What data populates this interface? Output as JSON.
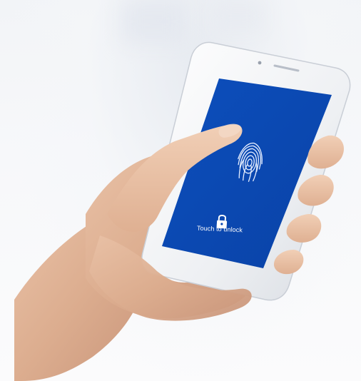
{
  "lock_screen": {
    "unlock_text": "Touch to unlock",
    "screen_color": "#0b48b3"
  },
  "icons": {
    "fingerprint": "fingerprint-icon",
    "lock": "lock-icon"
  }
}
